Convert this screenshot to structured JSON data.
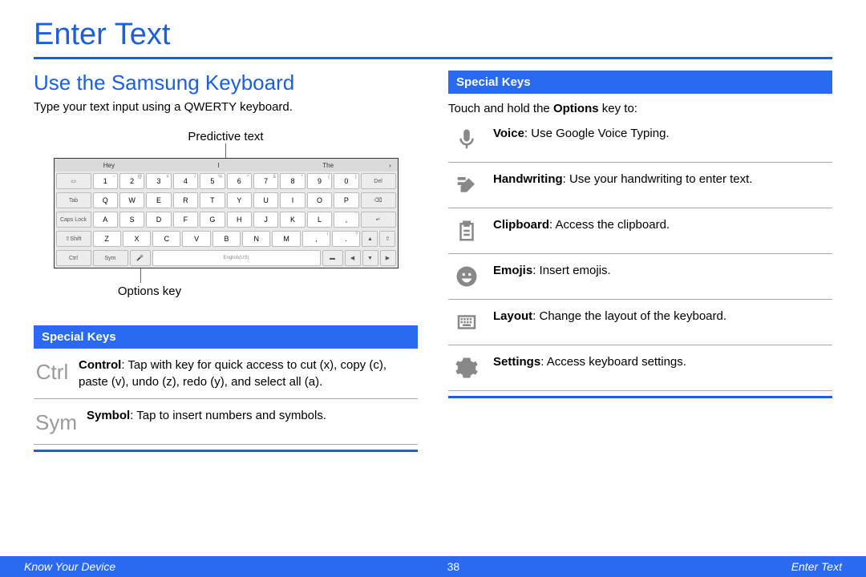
{
  "page_title": "Enter Text",
  "left": {
    "heading": "Use the Samsung Keyboard",
    "intro": "Type your text input using a QWERTY keyboard.",
    "callout_top": "Predictive text",
    "callout_bottom": "Options key",
    "keyboard": {
      "predict": [
        "Hey",
        "I",
        "The"
      ],
      "row_nums": [
        "1",
        "2",
        "3",
        "4",
        "5",
        "6",
        "7",
        "8",
        "9",
        "0"
      ],
      "row_nums_sup": [
        "~",
        "@",
        "#",
        "/",
        "%",
        "^",
        "&",
        "*",
        "(",
        ")"
      ],
      "row1": [
        "Q",
        "W",
        "E",
        "R",
        "T",
        "Y",
        "U",
        "I",
        "O",
        "P"
      ],
      "row2": [
        "A",
        "S",
        "D",
        "F",
        "G",
        "H",
        "J",
        "K",
        "L"
      ],
      "row3": [
        "Z",
        "X",
        "C",
        "V",
        "B",
        "N",
        "M"
      ],
      "mods": {
        "tab": "Tab",
        "caps": "Caps Lock",
        "shift": "Shift",
        "ctrl": "Ctrl",
        "sym": "Sym",
        "del": "Del",
        "lang": "English(US)"
      }
    },
    "special_bar": "Special Keys",
    "items": [
      {
        "icon_text": "Ctrl",
        "bold": "Control",
        "desc": ": Tap with key for quick access to cut (x), copy (c), paste (v), undo (z), redo (y), and select all (a)."
      },
      {
        "icon_text": "Sym",
        "bold": "Symbol",
        "desc": ": Tap to insert numbers and symbols."
      }
    ]
  },
  "right": {
    "special_bar": "Special Keys",
    "intro_prefix": "Touch and hold the ",
    "intro_bold": "Options",
    "intro_suffix": " key to:",
    "items": [
      {
        "icon": "mic",
        "bold": "Voice",
        "desc": ": Use Google Voice Typing."
      },
      {
        "icon": "handwriting",
        "bold": "Handwriting",
        "desc": ": Use your handwriting to enter text."
      },
      {
        "icon": "clipboard",
        "bold": "Clipboard",
        "desc": ": Access the clipboard."
      },
      {
        "icon": "emoji",
        "bold": "Emojis",
        "desc": ": Insert emojis."
      },
      {
        "icon": "layout",
        "bold": "Layout",
        "desc": ": Change the layout of the keyboard."
      },
      {
        "icon": "settings",
        "bold": "Settings",
        "desc": ": Access keyboard settings."
      }
    ]
  },
  "footer": {
    "left": "Know Your Device",
    "center": "38",
    "right": "Enter Text"
  }
}
